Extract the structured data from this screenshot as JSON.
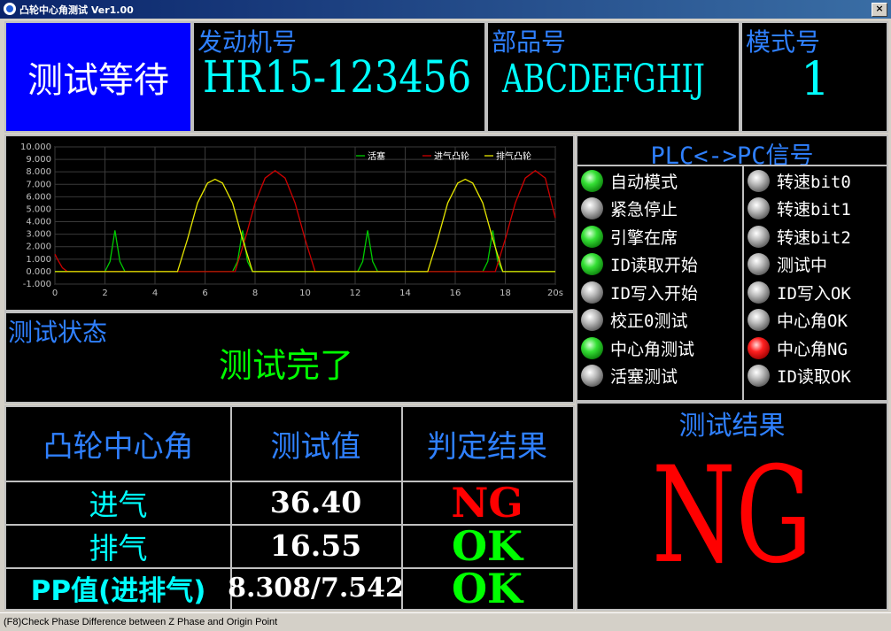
{
  "window": {
    "title": "凸轮中心角测试 Ver1.00",
    "close_label": "×"
  },
  "header": {
    "status": "测试等待",
    "engine_label": "发动机号",
    "engine_value": "HR15-123456",
    "part_label": "部品号",
    "part_value": "ABCDEFGHIJ",
    "mode_label": "模式号",
    "mode_value": "1"
  },
  "plc": {
    "title": "PLC<->PC信号",
    "left": [
      {
        "label": "自动模式",
        "state": "green"
      },
      {
        "label": "紧急停止",
        "state": "gray"
      },
      {
        "label": "引擎在席",
        "state": "green"
      },
      {
        "label": "ID读取开始",
        "state": "green"
      },
      {
        "label": "ID写入开始",
        "state": "gray"
      },
      {
        "label": "校正0测试",
        "state": "gray"
      },
      {
        "label": "中心角测试",
        "state": "green"
      },
      {
        "label": "活塞测试",
        "state": "gray"
      }
    ],
    "right": [
      {
        "label": "转速bit0",
        "state": "gray"
      },
      {
        "label": "转速bit1",
        "state": "gray"
      },
      {
        "label": "转速bit2",
        "state": "gray"
      },
      {
        "label": "测试中",
        "state": "gray"
      },
      {
        "label": "ID写入OK",
        "state": "gray"
      },
      {
        "label": "中心角OK",
        "state": "gray"
      },
      {
        "label": "中心角NG",
        "state": "red"
      },
      {
        "label": "ID读取OK",
        "state": "gray"
      }
    ]
  },
  "test_status": {
    "label": "测试状态",
    "value": "测试完了"
  },
  "results_table": {
    "headers": [
      "凸轮中心角",
      "测试值",
      "判定结果"
    ],
    "rows": [
      {
        "label": "进气",
        "value": "36.40",
        "judge": "NG",
        "judge_color": "#ff0000"
      },
      {
        "label": "排气",
        "value": "16.55",
        "judge": "OK",
        "judge_color": "#00ff00"
      },
      {
        "label": "PP值(进排气)",
        "value": "8.308/7.542",
        "judge": "OK",
        "judge_color": "#00ff00"
      }
    ]
  },
  "result": {
    "label": "测试结果",
    "value": "NG"
  },
  "statusbar": {
    "text": "(F8)Check Phase Difference  between Z Phase and Origin Point"
  },
  "chart_data": {
    "type": "line",
    "title": "",
    "xlabel": "",
    "ylabel": "",
    "xlim": [
      0,
      20
    ],
    "ylim": [
      -1,
      10
    ],
    "x_ticks": [
      "0",
      "2",
      "4",
      "6",
      "8",
      "10",
      "12",
      "14",
      "16",
      "18",
      "20s"
    ],
    "y_ticks": [
      "-1.000",
      "0.000",
      "1.000",
      "2.000",
      "3.000",
      "4.000",
      "5.000",
      "6.000",
      "7.000",
      "8.000",
      "9.000",
      "10.000"
    ],
    "grid": true,
    "legend_position": "top-right",
    "series": [
      {
        "name": "活塞",
        "color": "#00cc00",
        "x": [
          0,
          2.0,
          2.2,
          2.4,
          2.6,
          2.8,
          7.1,
          7.3,
          7.5,
          7.7,
          7.9,
          12.1,
          12.3,
          12.5,
          12.7,
          12.9,
          17.1,
          17.3,
          17.5,
          17.7,
          17.9,
          20
        ],
        "y": [
          0,
          0,
          0.8,
          3.3,
          0.8,
          0,
          0,
          0.8,
          3.3,
          0.8,
          0,
          0,
          0.8,
          3.3,
          0.8,
          0,
          0,
          0.8,
          3.3,
          0.8,
          0,
          0
        ]
      },
      {
        "name": "进气凸轮",
        "color": "#cc0000",
        "x": [
          0,
          0.1,
          0.3,
          0.5,
          7.2,
          7.6,
          8.0,
          8.4,
          8.8,
          9.2,
          9.6,
          10.0,
          10.4,
          17.6,
          18.0,
          18.4,
          18.8,
          19.2,
          19.6,
          20.0
        ],
        "y": [
          1.4,
          1.0,
          0.3,
          0,
          0,
          2.6,
          5.5,
          7.5,
          8.1,
          7.5,
          5.5,
          2.6,
          0,
          0,
          2.6,
          5.5,
          7.5,
          8.1,
          7.5,
          4.3
        ]
      },
      {
        "name": "排气凸轮",
        "color": "#e6e600",
        "x": [
          0,
          4.9,
          5.3,
          5.7,
          6.1,
          6.4,
          6.7,
          7.1,
          7.5,
          7.9,
          14.9,
          15.3,
          15.7,
          16.1,
          16.4,
          16.7,
          17.1,
          17.5,
          17.9,
          20
        ],
        "y": [
          0,
          0,
          2.6,
          5.5,
          7.1,
          7.4,
          7.1,
          5.5,
          2.6,
          0,
          0,
          2.6,
          5.5,
          7.1,
          7.4,
          7.1,
          5.5,
          2.6,
          0,
          0
        ]
      }
    ]
  }
}
